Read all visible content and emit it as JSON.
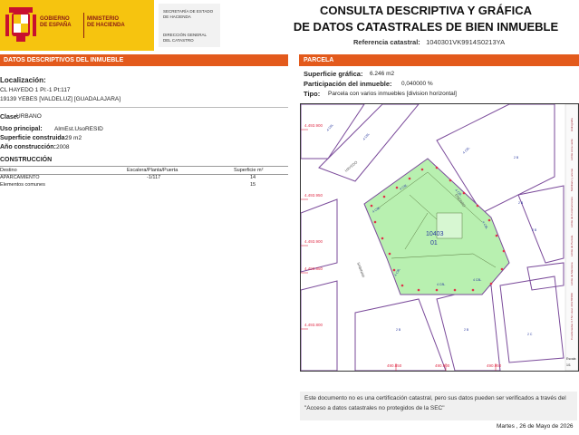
{
  "header": {
    "gov_line1": "GOBIERNO",
    "gov_line2": "DE ESPAÑA",
    "min_line1": "MINISTERIO",
    "min_line2": "DE HACIENDA",
    "sec_line1": "SECRETARÍA DE ESTADO",
    "sec_line2": "DE HACIENDA",
    "dg_line1": "DIRECCIÓN GENERAL",
    "dg_line2": "DEL CATASTRO",
    "title_line1": "CONSULTA DESCRIPTIVA Y GRÁFICA",
    "title_line2": "DE DATOS CATASTRALES DE BIEN INMUEBLE",
    "ref_label": "Referencia catastral:",
    "ref_value": "1040301VK9914S0213YA",
    "colors": {
      "yellow": "#f6c40f",
      "red": "#8b1c14",
      "orange": "#e35a1c"
    }
  },
  "left": {
    "section_title": "DATOS DESCRIPTIVOS DEL INMUEBLE",
    "localizacion_label": "Localización:",
    "address1": "CL HAYEDO 1 Pl:-1 Pt:117",
    "address2": "19139 YEBES [VALDELUZ] [GUADALAJARA]",
    "clase_label": "Clase:",
    "clase_value": "URBANO",
    "uso_label": "Uso principal:",
    "uso_value": "AlmEst.UsoRESID",
    "sup_label": "Superficie construida:",
    "sup_value": "29 m2",
    "anio_label": "Año construcción:",
    "anio_value": "2008",
    "construccion_title": "CONSTRUCCIÓN",
    "table": {
      "headers": [
        "Destino",
        "Escalera/Planta/Puerta",
        "Superficie m²"
      ],
      "rows": [
        [
          "APARCAMIENTO",
          "-1/117",
          "14"
        ],
        [
          "Elementos comunes",
          "",
          "15"
        ]
      ]
    }
  },
  "right": {
    "section_title": "PARCELA",
    "sup_graf_label": "Superficie gráfica:",
    "sup_graf_value": "6.246 m2",
    "part_label": "Participación del inmueble:",
    "part_value": "0,040000 %",
    "tipo_label": "Tipo:",
    "tipo_value": "Parcela con varios inmuebles [division horizontal]",
    "map": {
      "coords_left": [
        "4.493.900",
        "4.493.950",
        "4.493.900",
        "4.493.850",
        "4.493.800"
      ],
      "coords_bottom": [
        "490.850",
        "490.900",
        "490.950"
      ],
      "parcel_label_1": "10403",
      "parcel_label_2": "01",
      "side_text_1": "Coordenadas U.T.M. Huso 30 ETRS89",
      "side_text_2": "Límite de Manzana",
      "side_text_3": "Límite de Parcela",
      "side_text_4": "Límite de Construcciones",
      "side_text_5": "Mobiliario y aceras",
      "side_text_6": "Límite zona verde",
      "side_text_7": "Hidrografía",
      "escala_label": "Escala",
      "escala_value": "1/1",
      "street_1": "HAYEDO",
      "street_2": "SABINAR",
      "street_3": "ENEBRO",
      "colors": {
        "parcel": "#b8f0b0",
        "lines": "#7a4a9a",
        "labels": "#2a3aa0",
        "dots": "#e0304a"
      }
    },
    "notice": "Este documento no es una certificación catastral, pero sus datos pueden ser verificados a través del \"Acceso a datos catastrales no protegidos de la SEC\"",
    "date": "Martes , 26 de Mayo de 2026"
  }
}
